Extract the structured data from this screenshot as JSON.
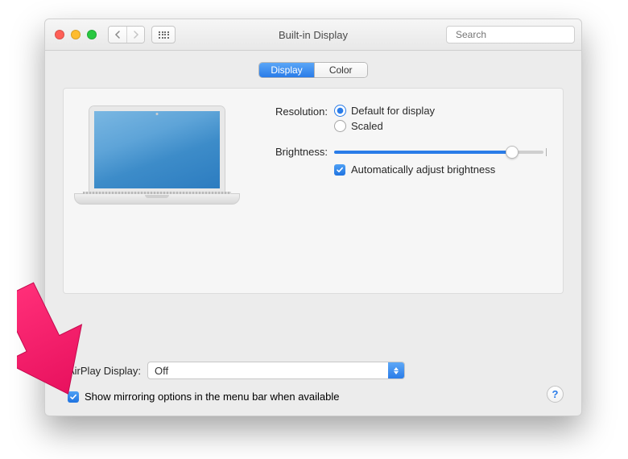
{
  "window": {
    "title": "Built-in Display"
  },
  "search": {
    "placeholder": "Search"
  },
  "tabs": {
    "display": "Display",
    "color": "Color"
  },
  "resolution": {
    "label": "Resolution:",
    "default_option": "Default for display",
    "scaled_option": "Scaled"
  },
  "brightness": {
    "label": "Brightness:",
    "auto_label": "Automatically adjust brightness",
    "value": 85
  },
  "airplay": {
    "label": "AirPlay Display:",
    "selected": "Off"
  },
  "mirroring": {
    "label": "Show mirroring options in the menu bar when available"
  },
  "help": {
    "glyph": "?"
  }
}
